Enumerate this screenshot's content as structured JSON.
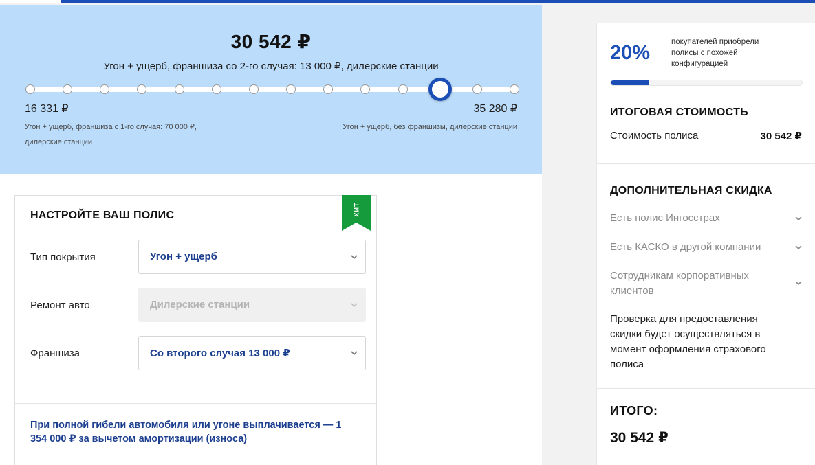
{
  "colors": {
    "accent": "#1b4fb6",
    "hero_bg": "#bbdcfa",
    "link_text": "#1c3f8f",
    "hit_badge": "#159a3c"
  },
  "hero": {
    "price": "30 542 ₽",
    "description": "Угон + ущерб, франшиза со 2-го случая: 13 000 ₽, дилерские станции",
    "slider": {
      "steps": 14,
      "selected_step": 11
    },
    "min_price": "16 331 ₽",
    "min_description": "Угон + ущерб, франшиза с 1-го случая: 70 000 ₽, дилерские станции",
    "max_price": "35 280 ₽",
    "max_description": "Угон + ущерб, без франшизы, дилерские станции"
  },
  "config": {
    "title": "НАСТРОЙТЕ ВАШ ПОЛИС",
    "badge": "ХИТ",
    "rows": [
      {
        "label": "Тип покрытия",
        "value": "Угон + ущерб",
        "disabled": false
      },
      {
        "label": "Ремонт авто",
        "value": "Дилерские станции",
        "disabled": true
      },
      {
        "label": "Франшиза",
        "value": "Со второго случая 13 000  ₽",
        "disabled": false
      }
    ],
    "note": "При полной гибели автомобиля или угоне выплачивается — 1 354 000 ₽ за вычетом амортизации (износа)"
  },
  "summary": {
    "popularity_percent_label": "20%",
    "popularity_fraction": 0.2,
    "popularity_text": "покупателей приобрели полисы с похожей конфигурацией",
    "total_heading": "ИТОГОВАЯ СТОИМОСТЬ",
    "cost_label": "Стоимость полиса",
    "cost_value": "30 542  ₽",
    "discount_heading": "ДОПОЛНИТЕЛЬНАЯ СКИДКА",
    "discounts": [
      "Есть полис Ингосстрах",
      "Есть КАСКО в другой компании",
      "Сотрудникам корпоративных клиентов"
    ],
    "check_note": "Проверка для предоставления скидки будет осуществляться в момент оформления страхового полиса",
    "itogo_label": "ИТОГО:",
    "itogo_value": "30 542 ₽"
  }
}
